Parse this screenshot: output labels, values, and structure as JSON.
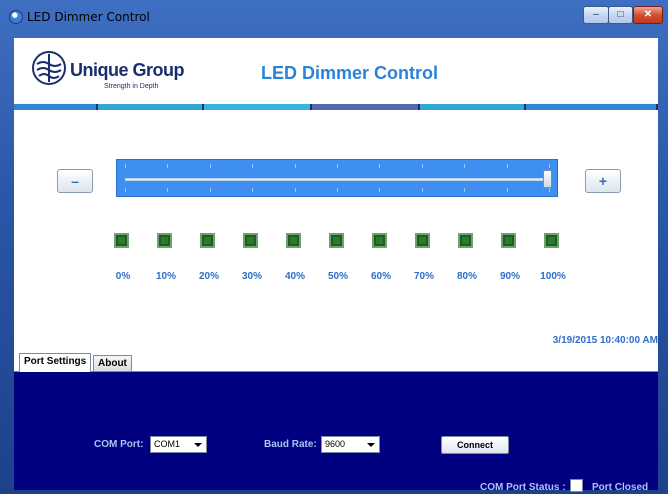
{
  "window": {
    "title": "LED Dimmer Control",
    "minimize_glyph": "–",
    "maximize_glyph": "□",
    "close_glyph": "✕"
  },
  "header": {
    "logo_name": "Unique Group",
    "logo_tagline": "Strength in Depth",
    "app_title": "LED Dimmer Control"
  },
  "stripe_colors": [
    "#2f86d1",
    "#2fa7d8",
    "#36b3e3",
    "#5566b3",
    "#2fa7d8",
    "#2f86d1"
  ],
  "slider": {
    "minus_label": "–",
    "plus_label": "+",
    "value_fraction": 1.0
  },
  "leds": [
    {
      "label": "0%"
    },
    {
      "label": "10%"
    },
    {
      "label": "20%"
    },
    {
      "label": "30%"
    },
    {
      "label": "40%"
    },
    {
      "label": "50%"
    },
    {
      "label": "60%"
    },
    {
      "label": "70%"
    },
    {
      "label": "80%"
    },
    {
      "label": "90%"
    },
    {
      "label": "100%"
    }
  ],
  "datetime": "3/19/2015 10:40:00 AM",
  "tabs": {
    "port_settings": "Port Settings",
    "about": "About"
  },
  "port": {
    "com_port_label": "COM Port:",
    "com_port_value": "COM1",
    "baud_rate_label": "Baud Rate:",
    "baud_rate_value": "9600",
    "connect_label": "Connect",
    "status_label": "COM Port Status :",
    "status_value": "Port Closed"
  },
  "colors": {
    "accent": "#2b82d6",
    "panel_bg": "#000080",
    "led_on": "#2b7a2e"
  }
}
